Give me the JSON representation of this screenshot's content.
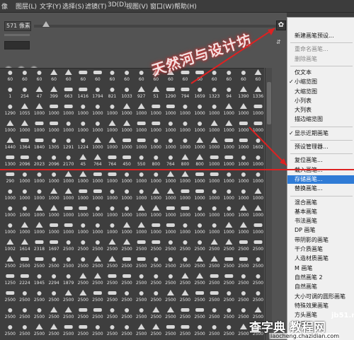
{
  "menubar": [
    {
      "id": "m0",
      "label": "像"
    },
    {
      "id": "m1",
      "label": "图层(L)"
    },
    {
      "id": "m2",
      "label": "文字(Y)"
    },
    {
      "id": "m3",
      "label": "选择(S)"
    },
    {
      "id": "m4",
      "label": "滤镜(T)"
    },
    {
      "id": "m5",
      "label": "3D(D)"
    },
    {
      "id": "m6",
      "label": "视图(V)"
    },
    {
      "id": "m7",
      "label": "窗口(W)"
    },
    {
      "id": "m8",
      "label": "帮助(H)"
    }
  ],
  "panel": {
    "size_value": "571 像素",
    "gear_symbol": "✿",
    "new_preset_symbol": "⇵"
  },
  "grid_sizes": [
    [
      "60",
      "60",
      "60",
      "60",
      "60",
      "60",
      "60",
      "60",
      "60",
      "60",
      "60",
      "60",
      "60",
      "60",
      "60",
      "60",
      "60",
      "60"
    ],
    [
      "1",
      "254",
      "47",
      "399",
      "663",
      "1416",
      "1794",
      "821",
      "1033",
      "927",
      "51",
      "1290",
      "794",
      "1659",
      "1323",
      "94",
      "1390",
      "1336"
    ],
    [
      "1290",
      "1055",
      "1000",
      "1000",
      "1000",
      "1000",
      "1000",
      "1000",
      "1000",
      "1000",
      "1000",
      "1000",
      "1000",
      "1000",
      "1000",
      "1000",
      "1000",
      "1000"
    ],
    [
      "1000",
      "1000",
      "1000",
      "1000",
      "1000",
      "1000",
      "1000",
      "1000",
      "1000",
      "1000",
      "1000",
      "1000",
      "1000",
      "1000",
      "1000",
      "1000",
      "1000",
      "1000"
    ],
    [
      "1440",
      "1364",
      "1840",
      "1305",
      "1291",
      "1224",
      "1000",
      "1000",
      "1000",
      "1000",
      "1000",
      "1000",
      "1000",
      "1000",
      "1000",
      "1000",
      "1000",
      "1602"
    ],
    [
      "1300",
      "2096",
      "2023",
      "2096",
      "2170",
      "45",
      "764",
      "764",
      "450",
      "550",
      "800",
      "764",
      "800",
      "800",
      "1000",
      "1000",
      "1000",
      "1000"
    ],
    [
      "290",
      "1000",
      "1000",
      "1000",
      "1000",
      "1000",
      "1000",
      "1000",
      "1000",
      "1000",
      "1000",
      "1000",
      "1000",
      "1000",
      "1000",
      "1000",
      "1000",
      "1000"
    ],
    [
      "1000",
      "1000",
      "1000",
      "1000",
      "1000",
      "1000",
      "1000",
      "1000",
      "1000",
      "1000",
      "1000",
      "1000",
      "1000",
      "1000",
      "1000",
      "1000",
      "1000",
      "1000"
    ],
    [
      "1000",
      "1000",
      "1000",
      "1000",
      "1000",
      "1000",
      "1000",
      "1000",
      "1000",
      "1000",
      "1000",
      "1000",
      "1000",
      "1000",
      "1000",
      "1000",
      "1000",
      "1000"
    ],
    [
      "1000",
      "1000",
      "1000",
      "1000",
      "1000",
      "1000",
      "1000",
      "1000",
      "1000",
      "1000",
      "1000",
      "1000",
      "1000",
      "1000",
      "1000",
      "1000",
      "1000",
      "1000"
    ],
    [
      "1002",
      "1614",
      "2318",
      "1697",
      "2500",
      "2500",
      "2500",
      "2500",
      "2500",
      "2500",
      "2500",
      "2500",
      "2500",
      "2500",
      "2500",
      "2500",
      "2500",
      "2500"
    ],
    [
      "2500",
      "2500",
      "2500",
      "2500",
      "2500",
      "2500",
      "2500",
      "2500",
      "2500",
      "2500",
      "2500",
      "2500",
      "2500",
      "2500",
      "2500",
      "2500",
      "2500",
      "2500"
    ],
    [
      "1250",
      "2224",
      "1945",
      "2294",
      "1879",
      "2500",
      "2500",
      "2500",
      "2500",
      "2500",
      "2500",
      "2500",
      "2500",
      "2500",
      "2500",
      "2500",
      "2500",
      "2500"
    ],
    [
      "2500",
      "2500",
      "2500",
      "2500",
      "2500",
      "2500",
      "2500",
      "2500",
      "2500",
      "2500",
      "2500",
      "2500",
      "2500",
      "2500",
      "2500",
      "2500",
      "2500",
      "2500"
    ],
    [
      "2500",
      "2500",
      "2500",
      "2500",
      "2500",
      "2500",
      "2500",
      "2500",
      "2500",
      "2500",
      "2500",
      "2500",
      "2500",
      "2500",
      "2500",
      "2500",
      "2500",
      "2500"
    ],
    [
      "2500",
      "2500",
      "2500",
      "2500",
      "2500",
      "2500",
      "2500",
      "2500",
      "2500",
      "2500",
      "2500",
      "2500",
      "2500",
      "2500",
      "2500",
      "2500",
      "2500",
      "2500"
    ]
  ],
  "context_menu": [
    {
      "label": "新建画笔预设...",
      "checked": false,
      "highlight": false,
      "disabled": false,
      "sep_before": false
    },
    {
      "label": "重命名画笔...",
      "checked": false,
      "highlight": false,
      "disabled": true,
      "sep_before": true
    },
    {
      "label": "删除画笔",
      "checked": false,
      "highlight": false,
      "disabled": true,
      "sep_before": false
    },
    {
      "label": "仅文本",
      "checked": false,
      "highlight": false,
      "disabled": false,
      "sep_before": true
    },
    {
      "label": "小缩览图",
      "checked": true,
      "highlight": false,
      "disabled": false,
      "sep_before": false
    },
    {
      "label": "大缩览图",
      "checked": false,
      "highlight": false,
      "disabled": false,
      "sep_before": false
    },
    {
      "label": "小列表",
      "checked": false,
      "highlight": false,
      "disabled": false,
      "sep_before": false
    },
    {
      "label": "大列表",
      "checked": false,
      "highlight": false,
      "disabled": false,
      "sep_before": false
    },
    {
      "label": "描边缩览图",
      "checked": false,
      "highlight": false,
      "disabled": false,
      "sep_before": false
    },
    {
      "label": "显示近期画笔",
      "checked": true,
      "highlight": false,
      "disabled": false,
      "sep_before": true
    },
    {
      "label": "预设管理器...",
      "checked": false,
      "highlight": false,
      "disabled": false,
      "sep_before": true
    },
    {
      "label": "复位画笔...",
      "checked": false,
      "highlight": false,
      "disabled": false,
      "sep_before": true
    },
    {
      "label": "载入画笔...",
      "checked": false,
      "highlight": false,
      "disabled": false,
      "sep_before": false
    },
    {
      "label": "存储画笔...",
      "checked": false,
      "highlight": true,
      "disabled": false,
      "sep_before": false
    },
    {
      "label": "替换画笔...",
      "checked": false,
      "highlight": false,
      "disabled": false,
      "sep_before": false
    },
    {
      "label": "混合画笔",
      "checked": false,
      "highlight": false,
      "disabled": false,
      "sep_before": true
    },
    {
      "label": "基本画笔",
      "checked": false,
      "highlight": false,
      "disabled": false,
      "sep_before": false
    },
    {
      "label": "书法画笔",
      "checked": false,
      "highlight": false,
      "disabled": false,
      "sep_before": false
    },
    {
      "label": "DP 画笔",
      "checked": false,
      "highlight": false,
      "disabled": false,
      "sep_before": false
    },
    {
      "label": "带阴影的画笔",
      "checked": false,
      "highlight": false,
      "disabled": false,
      "sep_before": false
    },
    {
      "label": "干介质画笔",
      "checked": false,
      "highlight": false,
      "disabled": false,
      "sep_before": false
    },
    {
      "label": "人造材质画笔",
      "checked": false,
      "highlight": false,
      "disabled": false,
      "sep_before": false
    },
    {
      "label": "M 画笔",
      "checked": false,
      "highlight": false,
      "disabled": false,
      "sep_before": false
    },
    {
      "label": "自然画笔 2",
      "checked": false,
      "highlight": false,
      "disabled": false,
      "sep_before": false
    },
    {
      "label": "自然画笔",
      "checked": false,
      "highlight": false,
      "disabled": false,
      "sep_before": false
    },
    {
      "label": "大小可调的圆形画笔",
      "checked": false,
      "highlight": false,
      "disabled": false,
      "sep_before": false
    },
    {
      "label": "特殊效果画笔",
      "checked": false,
      "highlight": false,
      "disabled": false,
      "sep_before": false
    },
    {
      "label": "方头画笔",
      "checked": false,
      "highlight": false,
      "disabled": false,
      "sep_before": false
    },
    {
      "label": "粗画笔",
      "checked": false,
      "highlight": false,
      "disabled": false,
      "sep_before": false
    }
  ],
  "watermark": {
    "text": "天然河与设计坊",
    "footer_big": "查字典 教程网",
    "footer_site": "jb51.net",
    "footer_url": "jiaocheng.chazidian.com"
  },
  "colors": {
    "panel_bg": "#535353",
    "grid_bg": "#3e3e3e",
    "menu_bg": "#f0f0f0",
    "menu_highlight": "#2f7bd6",
    "annotation_red": "#dd2222"
  }
}
